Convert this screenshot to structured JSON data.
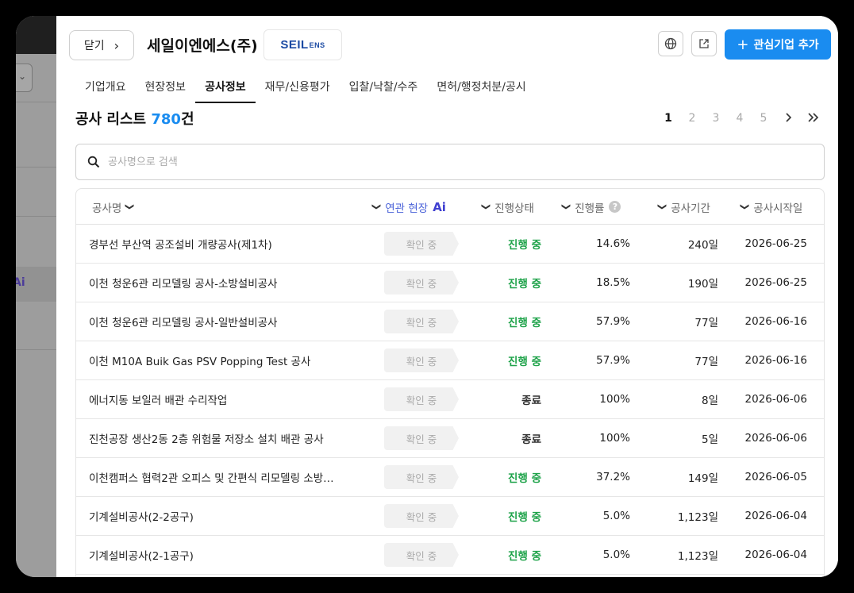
{
  "header": {
    "close_label": "닫기",
    "company_name": "세일이엔에스(주)",
    "logo_text": "SEIL",
    "logo_small": "ENS",
    "add_label": "관심기업 추가"
  },
  "tabs": [
    {
      "label": "기업개요"
    },
    {
      "label": "현장정보"
    },
    {
      "label": "공사정보",
      "active": true
    },
    {
      "label": "재무/신용평가"
    },
    {
      "label": "입찰/낙찰/수주"
    },
    {
      "label": "면허/행정처분/공시"
    }
  ],
  "list": {
    "title": "공사 리스트",
    "count": "780",
    "count_unit": "건"
  },
  "pager": {
    "pages": [
      "1",
      "2",
      "3",
      "4",
      "5"
    ],
    "current": "1"
  },
  "search": {
    "placeholder": "공사명으로 검색"
  },
  "columns": {
    "name": "공사명",
    "related": "연관 현장",
    "related_ai": "Ai",
    "status": "진행상태",
    "rate": "진행률",
    "period": "공사기간",
    "start": "공사시작일"
  },
  "rows": [
    {
      "name": "경부선 부산역 공조설비 개량공사(제1차)",
      "related": "확인 중",
      "status": "진행 중",
      "rate": "14.6%",
      "period": "240일",
      "start": "2026-06-25"
    },
    {
      "name": "이천 청운6관 리모델링 공사-소방설비공사",
      "related": "확인 중",
      "status": "진행 중",
      "rate": "18.5%",
      "period": "190일",
      "start": "2026-06-25"
    },
    {
      "name": "이천 청운6관 리모델링 공사-일반설비공사",
      "related": "확인 중",
      "status": "진행 중",
      "rate": "57.9%",
      "period": "77일",
      "start": "2026-06-16"
    },
    {
      "name": "이천 M10A Buik Gas PSV Popping Test 공사",
      "related": "확인 중",
      "status": "진행 중",
      "rate": "57.9%",
      "period": "77일",
      "start": "2026-06-16"
    },
    {
      "name": "에너지동 보일러 배관 수리작업",
      "related": "확인 중",
      "status": "종료",
      "rate": "100%",
      "period": "8일",
      "start": "2026-06-06"
    },
    {
      "name": "진천공장 생산2동 2층 위험물 저장소 설치 배관 공사",
      "related": "확인 중",
      "status": "종료",
      "rate": "100%",
      "period": "5일",
      "start": "2026-06-06"
    },
    {
      "name": "이천캠퍼스 협력2관 오피스 및 간편식 리모델링 소방…",
      "related": "확인 중",
      "status": "진행 중",
      "rate": "37.2%",
      "period": "149일",
      "start": "2026-06-05"
    },
    {
      "name": "기계설비공사(2-2공구)",
      "related": "확인 중",
      "status": "진행 중",
      "rate": "5.0%",
      "period": "1,123일",
      "start": "2026-06-04"
    },
    {
      "name": "기계설비공사(2-1공구)",
      "related": "확인 중",
      "status": "진행 중",
      "rate": "5.0%",
      "period": "1,123일",
      "start": "2026-06-04"
    }
  ],
  "colors": {
    "accent": "#1a8cf0",
    "status_progress": "#1fa34a",
    "status_done": "#333333",
    "ai": "#3f3fd0"
  }
}
